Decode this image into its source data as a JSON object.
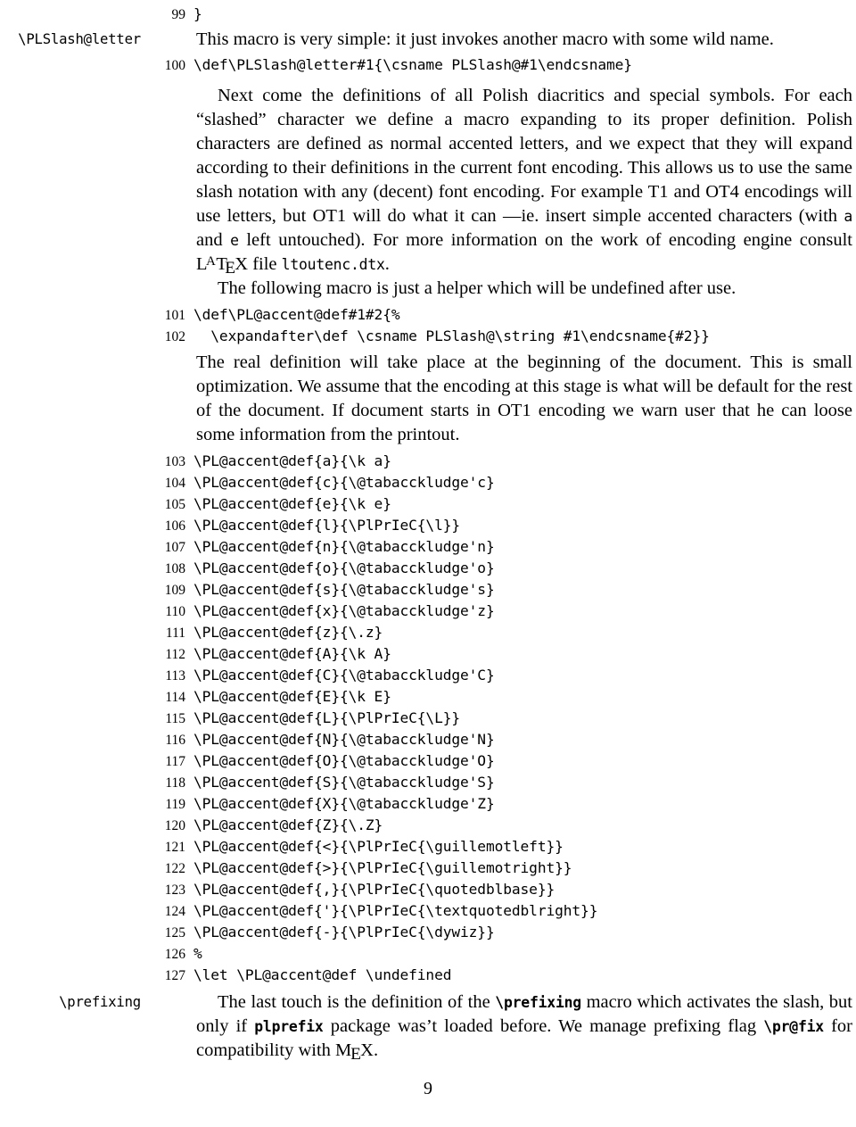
{
  "document": {
    "kind": "latex-dtx-documentation",
    "page_number": "9"
  },
  "margin_labels": {
    "plslash_letter": "\\PLSlash@letter",
    "prefixing": "\\prefixing"
  },
  "code_lines": [
    {
      "n": "99",
      "text": "}"
    },
    {
      "n": "100",
      "text": "\\def\\PLSlash@letter#1{\\csname PLSlash@#1\\endcsname}"
    },
    {
      "n": "101",
      "text": "\\def\\PL@accent@def#1#2{%"
    },
    {
      "n": "102",
      "text": "  \\expandafter\\def \\csname PLSlash@\\string #1\\endcsname{#2}}"
    },
    {
      "n": "103",
      "text": "\\PL@accent@def{a}{\\k a}"
    },
    {
      "n": "104",
      "text": "\\PL@accent@def{c}{\\@tabacckludge'c}"
    },
    {
      "n": "105",
      "text": "\\PL@accent@def{e}{\\k e}"
    },
    {
      "n": "106",
      "text": "\\PL@accent@def{l}{\\PlPrIeC{\\l}}"
    },
    {
      "n": "107",
      "text": "\\PL@accent@def{n}{\\@tabacckludge'n}"
    },
    {
      "n": "108",
      "text": "\\PL@accent@def{o}{\\@tabacckludge'o}"
    },
    {
      "n": "109",
      "text": "\\PL@accent@def{s}{\\@tabacckludge's}"
    },
    {
      "n": "110",
      "text": "\\PL@accent@def{x}{\\@tabacckludge'z}"
    },
    {
      "n": "111",
      "text": "\\PL@accent@def{z}{\\.z}"
    },
    {
      "n": "112",
      "text": "\\PL@accent@def{A}{\\k A}"
    },
    {
      "n": "113",
      "text": "\\PL@accent@def{C}{\\@tabacckludge'C}"
    },
    {
      "n": "114",
      "text": "\\PL@accent@def{E}{\\k E}"
    },
    {
      "n": "115",
      "text": "\\PL@accent@def{L}{\\PlPrIeC{\\L}}"
    },
    {
      "n": "116",
      "text": "\\PL@accent@def{N}{\\@tabacckludge'N}"
    },
    {
      "n": "117",
      "text": "\\PL@accent@def{O}{\\@tabacckludge'O}"
    },
    {
      "n": "118",
      "text": "\\PL@accent@def{S}{\\@tabacckludge'S}"
    },
    {
      "n": "119",
      "text": "\\PL@accent@def{X}{\\@tabacckludge'Z}"
    },
    {
      "n": "120",
      "text": "\\PL@accent@def{Z}{\\.Z}"
    },
    {
      "n": "121",
      "text": "\\PL@accent@def{<}{\\PlPrIeC{\\guillemotleft}}"
    },
    {
      "n": "122",
      "text": "\\PL@accent@def{>}{\\PlPrIeC{\\guillemotright}}"
    },
    {
      "n": "123",
      "text": "\\PL@accent@def{,}{\\PlPrIeC{\\quotedblbase}}"
    },
    {
      "n": "124",
      "text": "\\PL@accent@def{'}{\\PlPrIeC{\\textquotedblright}}"
    },
    {
      "n": "125",
      "text": "\\PL@accent@def{-}{\\PlPrIeC{\\dywiz}}"
    },
    {
      "n": "126",
      "text": "%"
    },
    {
      "n": "127",
      "text": "\\let \\PL@accent@def \\undefined"
    }
  ],
  "paragraphs": {
    "p1": "This macro is very simple: it just invokes another macro with some wild name.",
    "p2_a": "Next come the definitions of all Polish diacritics and special symbols. For each “slashed” character we define a macro expanding to its proper definition. Polish characters are defined as normal accented letters, and we expect that they will expand according to their definitions in the current font encoding. This allows us to use the same slash notation with any (decent) font encoding. For example T1 and OT4 encodings will use letters, but OT1 will do what it can —ie. insert simple accented characters (with ",
    "p2_code_a": "a",
    "p2_b": " and ",
    "p2_code_e": "e",
    "p2_c": " left untouched). For more information on the work of encoding engine consult ",
    "p2_logo_latex": "LaTeX",
    "p2_d": " file ",
    "p2_code_file": "ltoutenc.dtx",
    "p2_e": ".",
    "p3": "The following macro is just a helper which will be undefined after use.",
    "p4": "The real definition will take place at the beginning of the document. This is small optimization. We assume that the encoding at this stage is what will be default for the rest of the document. If document starts in OT1 encoding we warn user that he can loose some information from the printout.",
    "p5_a": "The last touch is the definition of the ",
    "p5_code_prefixing": "\\prefixing",
    "p5_b": " macro which activates the slash, but only if ",
    "p5_code_plprefix": "plprefix",
    "p5_c": " package was’t loaded before. We manage prefixing flag ",
    "p5_code_prfix": "\\pr@fix",
    "p5_d": " for compatibility with ",
    "p5_logo_mex": "MeX",
    "p5_e": "."
  }
}
